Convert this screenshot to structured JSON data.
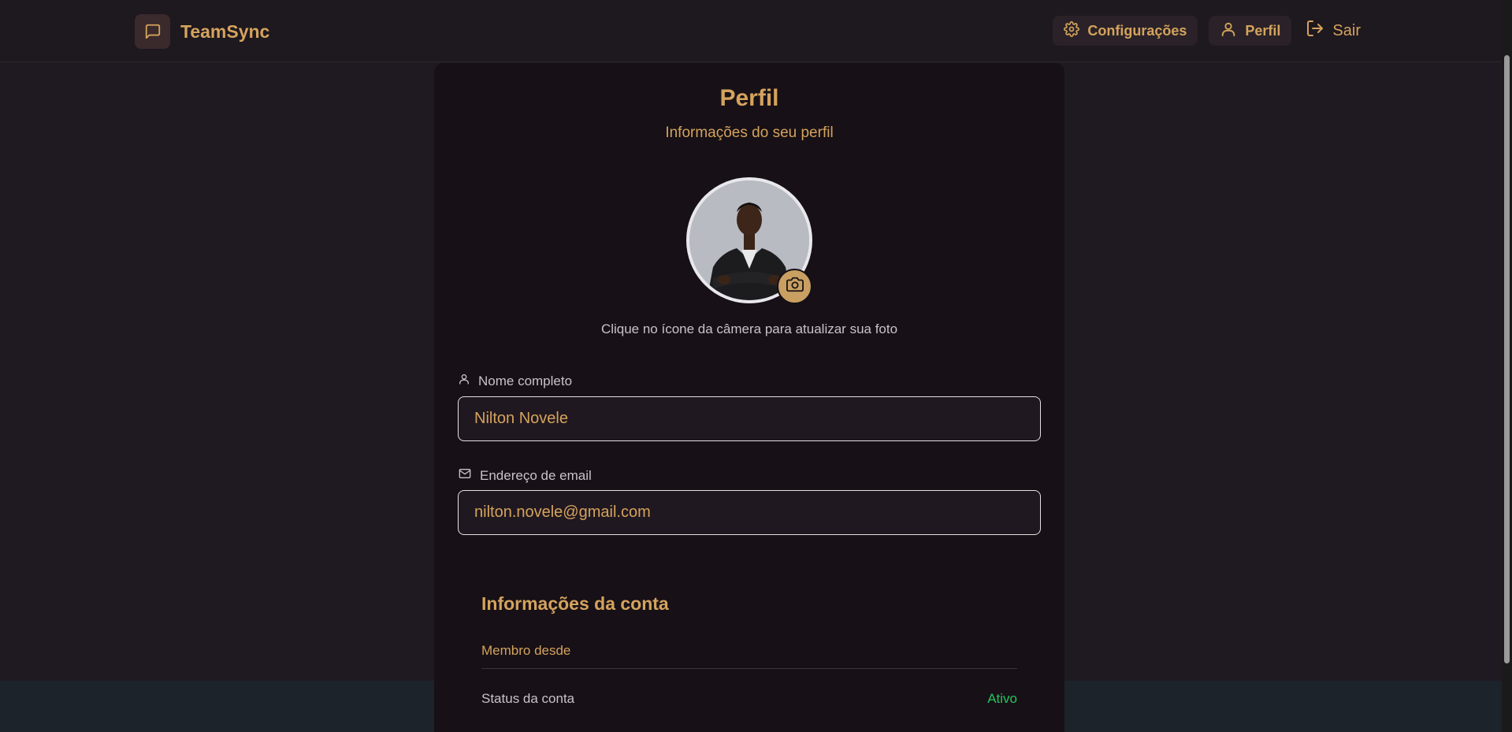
{
  "header": {
    "brand": "TeamSync",
    "nav": [
      {
        "label": "Configurações",
        "icon": "gear-icon"
      },
      {
        "label": "Perfil",
        "icon": "user-icon"
      },
      {
        "label": "Sair",
        "icon": "logout-icon"
      }
    ]
  },
  "profile": {
    "title": "Perfil",
    "subtitle": "Informações do seu perfil",
    "photo_hint": "Clique no ícone da câmera para atualizar sua foto",
    "name_label": "Nome completo",
    "name_value": "Nilton Novele",
    "email_label": "Endereço de email",
    "email_value": "nilton.novele@gmail.com"
  },
  "account": {
    "title": "Informações da conta",
    "member_since_label": "Membro desde",
    "member_since_value": "",
    "status_label": "Status da conta",
    "status_value": "Ativo"
  },
  "colors": {
    "accent": "#d4a35d",
    "status_active": "#22c55e",
    "background": "#1f1a22",
    "card": "#171016"
  }
}
